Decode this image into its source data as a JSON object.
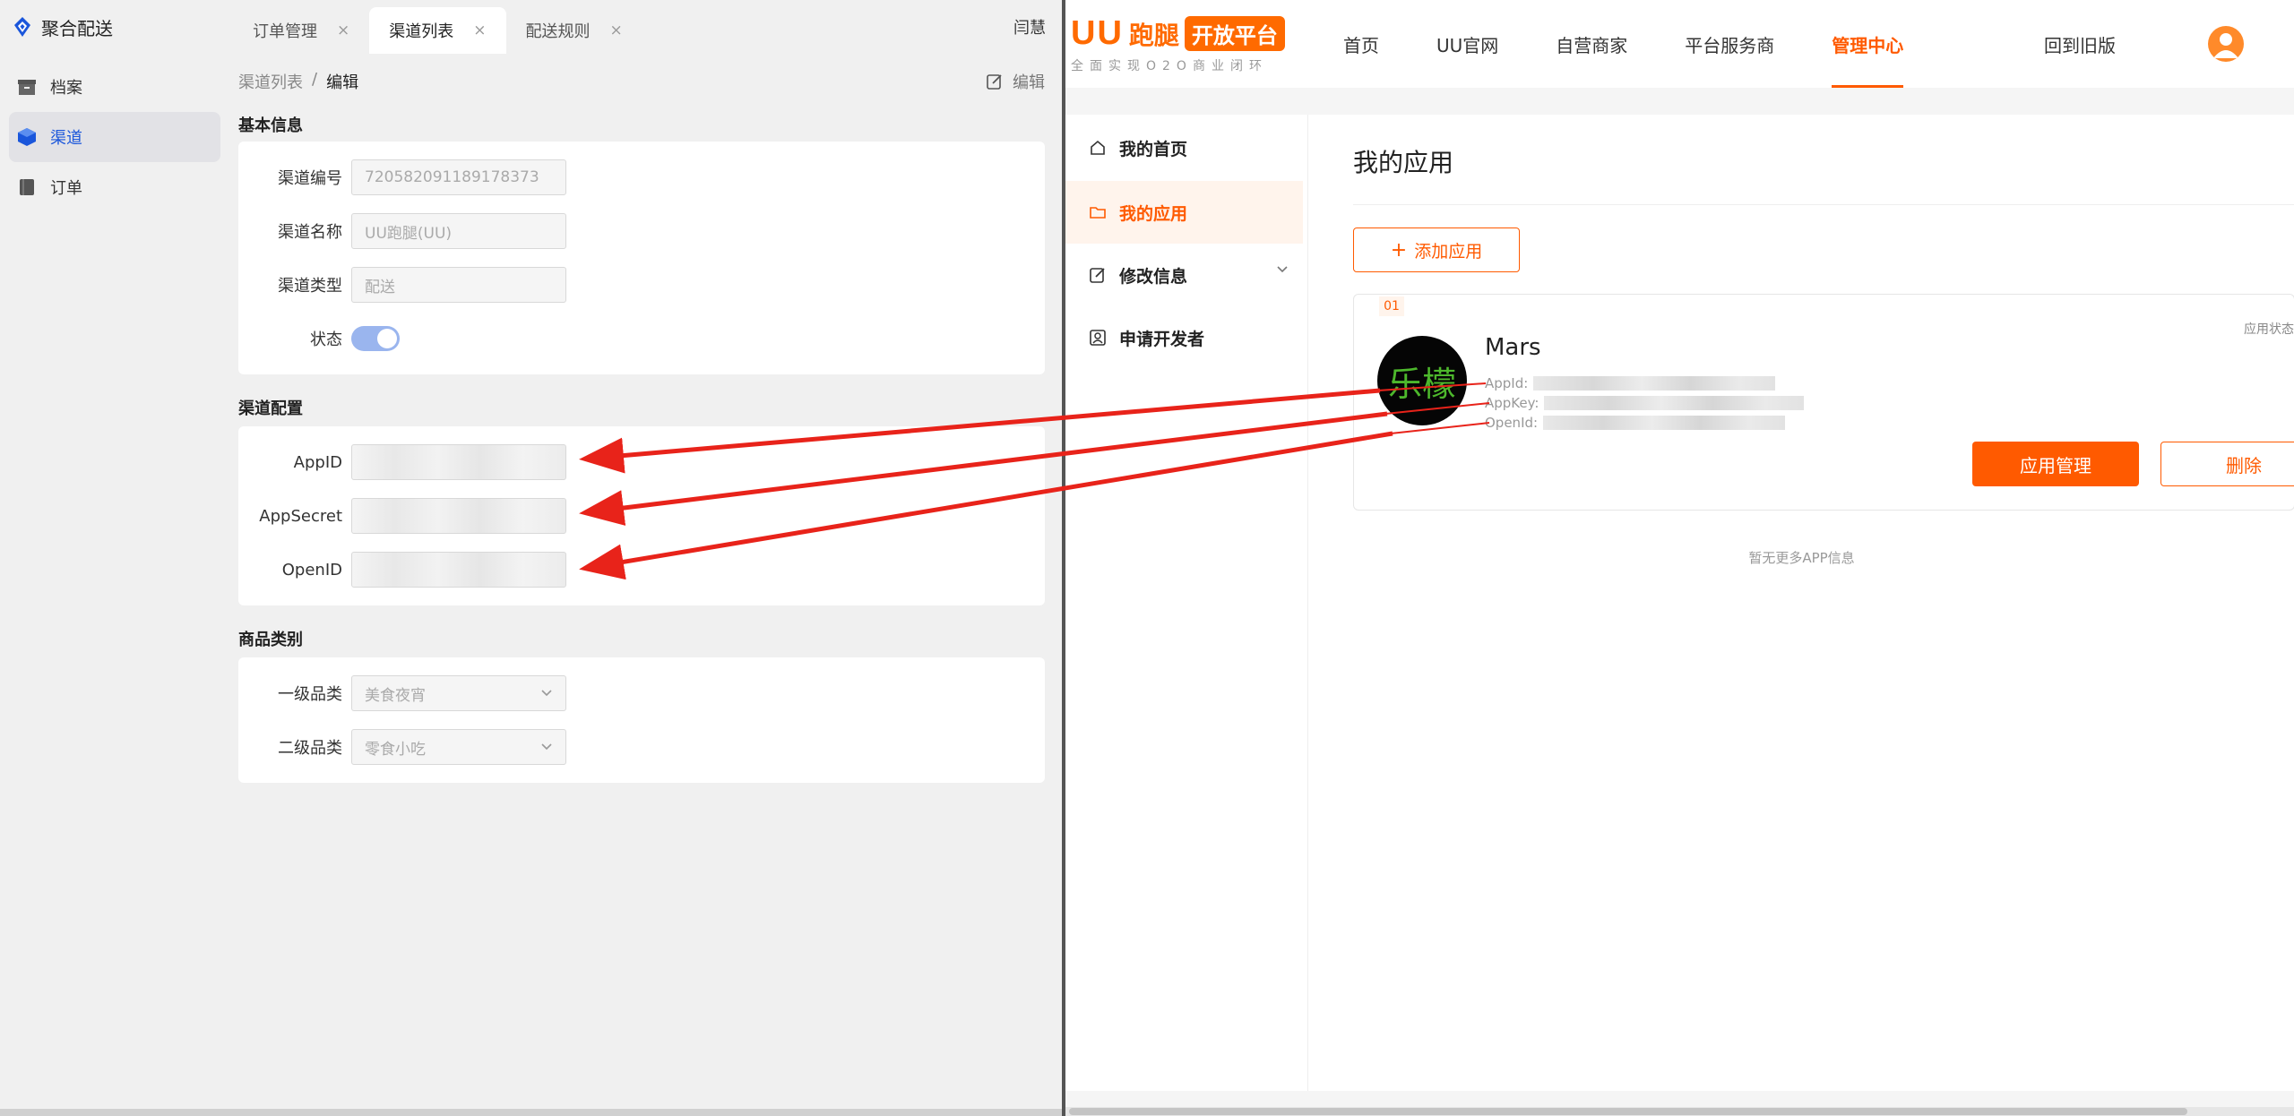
{
  "left": {
    "brand": {
      "name": "聚合配送",
      "logo_icon": "diamond-logo-icon"
    },
    "tabs": [
      {
        "label": "订单管理",
        "close": "×",
        "active": false
      },
      {
        "label": "渠道列表",
        "close": "×",
        "active": true
      },
      {
        "label": "配送规则",
        "close": "×",
        "active": false
      }
    ],
    "user": "闫慧",
    "sidebar": {
      "items": [
        {
          "label": "档案",
          "icon": "archive-icon",
          "active": false
        },
        {
          "label": "渠道",
          "icon": "layers-icon",
          "active": true
        },
        {
          "label": "订单",
          "icon": "book-icon",
          "active": false
        }
      ],
      "collapse_icon": "collapse-left-icon"
    },
    "breadcrumb": {
      "parent": "渠道列表",
      "separator": "/",
      "current": "编辑"
    },
    "edit_button": "编辑",
    "basic": {
      "title": "基本信息",
      "channel_no_label": "渠道编号",
      "channel_no_value": "720582091189178373",
      "channel_name_label": "渠道名称",
      "channel_name_value": "UU跑腿(UU)",
      "channel_type_label": "渠道类型",
      "channel_type_value": "配送",
      "status_label": "状态",
      "status_on": true
    },
    "config": {
      "title": "渠道配置",
      "appid_label": "AppID",
      "appsecret_label": "AppSecret",
      "openid_label": "OpenID"
    },
    "category": {
      "title": "商品类别",
      "level1_label": "一级品类",
      "level1_value": "美食夜宵",
      "level2_label": "二级品类",
      "level2_value": "零食小吃"
    }
  },
  "right": {
    "logo": {
      "uu": "UU",
      "name": "跑腿",
      "badge": "开放平台",
      "slogan": "全面实现O2O商业闭环"
    },
    "nav": [
      "首页",
      "UU官网",
      "自营商家",
      "平台服务商",
      "管理中心"
    ],
    "nav_active": "管理中心",
    "old_version": "回到旧版",
    "sidebar": [
      {
        "label": "我的首页",
        "icon": "home-icon",
        "active": false
      },
      {
        "label": "我的应用",
        "icon": "folder-icon",
        "active": true
      },
      {
        "label": "修改信息",
        "icon": "edit-icon",
        "active": false
      },
      {
        "label": "申请开发者",
        "icon": "user-card-icon",
        "active": false
      }
    ],
    "page_title": "我的应用",
    "add_button": "添加应用",
    "app": {
      "index": "01",
      "status_label": "应用状态",
      "logo_text": "乐檬",
      "name": "Mars",
      "appid_label": "AppId:",
      "appkey_label": "AppKey:",
      "openid_label": "OpenId:"
    },
    "manage_button": "应用管理",
    "delete_button": "删除",
    "no_more": "暂无更多APP信息"
  },
  "colors": {
    "accent_orange": "#ff5a00",
    "accent_blue": "#1a56db",
    "arrow_red": "#e8231a"
  }
}
